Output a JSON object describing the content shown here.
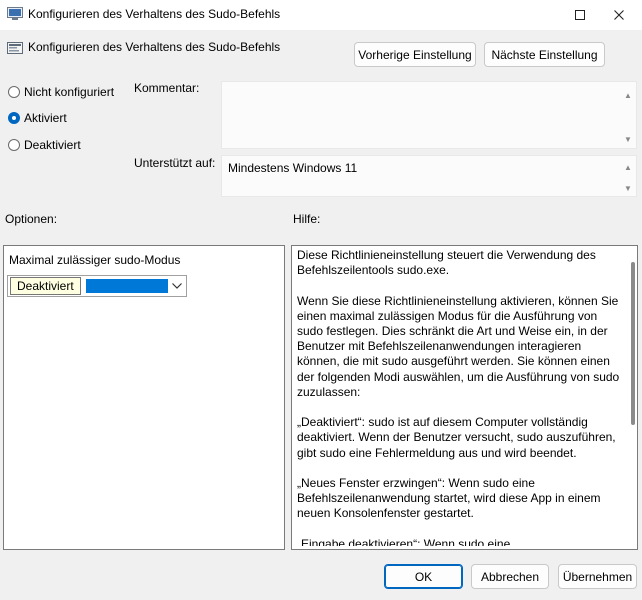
{
  "window": {
    "title": "Konfigurieren des Verhaltens des Sudo-Befehls",
    "maximize_icon": "maximize-icon",
    "close_icon": "close-icon"
  },
  "header": {
    "title": "Konfigurieren des Verhaltens des Sudo-Befehls",
    "prev_button": "Vorherige Einstellung",
    "next_button": "Nächste Einstellung"
  },
  "state": {
    "options": [
      {
        "label": "Nicht konfiguriert",
        "checked": false
      },
      {
        "label": "Aktiviert",
        "checked": true
      },
      {
        "label": "Deaktiviert",
        "checked": false
      }
    ]
  },
  "comment": {
    "label": "Kommentar:",
    "value": ""
  },
  "supported": {
    "label": "Unterstützt auf:",
    "value": "Mindestens Windows 11"
  },
  "options_section": {
    "label": "Optionen:",
    "field_label": "Maximal zulässiger sudo-Modus",
    "tooltip": "Deaktiviert"
  },
  "help_section": {
    "label": "Hilfe:",
    "paragraphs": [
      "Diese Richtlinieneinstellung steuert die Verwendung des Befehlszeilentools sudo.exe.",
      "Wenn Sie diese Richtlinieneinstellung aktivieren, können Sie einen maximal zulässigen Modus für die Ausführung von sudo festlegen. Dies schränkt die Art und Weise ein, in der Benutzer mit Befehlszeilenanwendungen interagieren können, die mit sudo ausgeführt werden. Sie können einen der folgenden Modi auswählen, um die Ausführung von sudo zuzulassen:",
      "„Deaktiviert“: sudo ist auf diesem Computer vollständig deaktiviert. Wenn der Benutzer versucht, sudo auszuführen, gibt sudo eine Fehlermeldung aus und wird beendet.",
      "„Neues Fenster erzwingen“: Wenn sudo eine Befehlszeilenanwendung startet, wird diese App in einem neuen Konsolenfenster gestartet.",
      "„Eingabe deaktivieren“: Wenn sudo eine Befehlszeilenanwendung startet, wird die App im aktuellen Konsolenfenster gestartet, aber"
    ]
  },
  "footer": {
    "ok": "OK",
    "cancel": "Abbrechen",
    "apply": "Übernehmen"
  },
  "colors": {
    "accent": "#0067c0",
    "selection": "#0078d7",
    "tooltip_bg": "#ffffe1"
  }
}
